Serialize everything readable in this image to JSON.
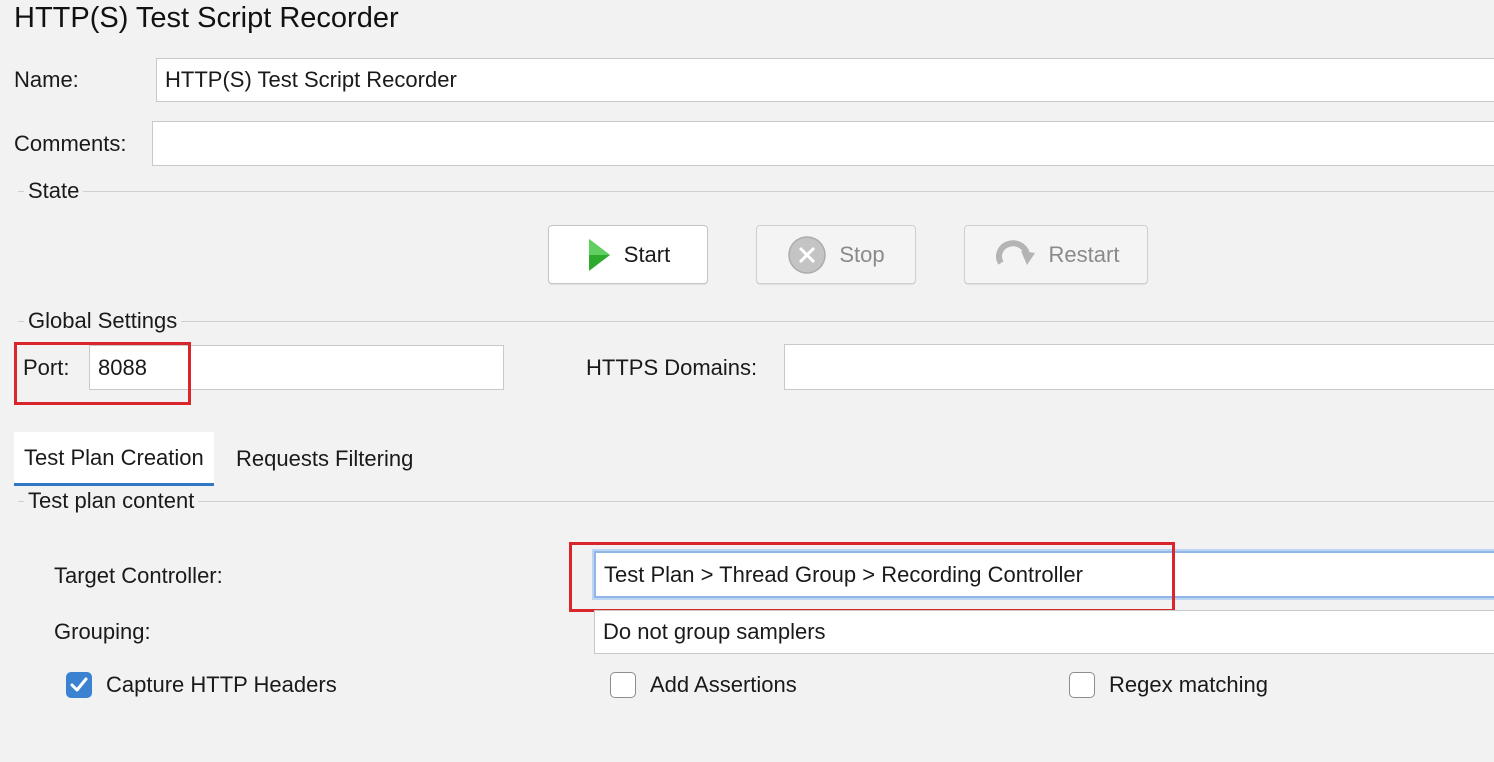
{
  "window": {
    "title": "HTTP(S) Test Script Recorder"
  },
  "name_field": {
    "label": "Name:",
    "value": "HTTP(S) Test Script Recorder"
  },
  "comments_field": {
    "label": "Comments:",
    "value": ""
  },
  "state": {
    "title": "State",
    "start_label": "Start",
    "stop_label": "Stop",
    "restart_label": "Restart"
  },
  "global_settings": {
    "title": "Global Settings",
    "port_label": "Port:",
    "port_value": "8088",
    "https_domains_label": "HTTPS Domains:",
    "https_domains_value": ""
  },
  "tabs": [
    {
      "label": "Test Plan Creation",
      "active": true
    },
    {
      "label": "Requests Filtering",
      "active": false
    }
  ],
  "test_plan_content": {
    "title": "Test plan content",
    "target_controller_label": "Target Controller:",
    "target_controller_value": "Test Plan > Thread Group > Recording Controller",
    "grouping_label": "Grouping:",
    "grouping_value": "Do not group samplers"
  },
  "checkboxes": [
    {
      "label": "Capture HTTP Headers",
      "checked": true
    },
    {
      "label": "Add Assertions",
      "checked": false
    },
    {
      "label": "Regex matching",
      "checked": false
    }
  ],
  "colors": {
    "highlight": "#d9262c",
    "accent": "#3b82d0",
    "start_icon": "#2eaa2e"
  },
  "icons": {
    "start": "play-icon",
    "stop": "stop-icon",
    "restart": "restart-icon",
    "check": "checkmark-icon"
  }
}
